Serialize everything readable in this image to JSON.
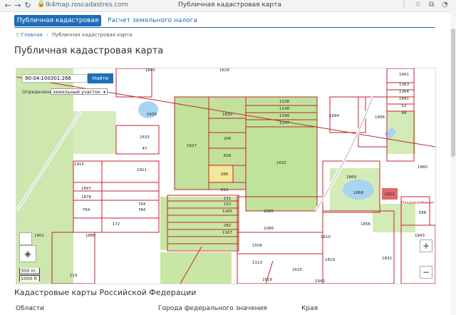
{
  "browser": {
    "url": "lk4map.roscadastres.com",
    "tab_title": "Публичная кадастровая карта"
  },
  "tabs": {
    "active": "Публичная кадастровая карта",
    "other": "Расчет земельного налога"
  },
  "breadcrumb": {
    "home": "Главная",
    "current": "Публичная кадастровая карта"
  },
  "page_title": "Публичная кадастровая карта",
  "map": {
    "search_value": "90:04:100301:266",
    "find_label": "Найти",
    "definition_label": "Определение:",
    "definition_value": "земельный участок",
    "scale_m": "300 m",
    "scale_ft": "1000 ft",
    "zoom_in": "+",
    "zoom_out": "−",
    "labels": [
      "1645",
      "1628",
      "1635",
      "1630",
      "1138",
      "1148",
      "1149",
      "1147",
      "1894",
      "1906",
      "1461",
      "1363",
      "1364",
      "1891",
      "52",
      "48",
      "1633",
      "47",
      "1627",
      "206",
      "818",
      "1632",
      "1880",
      "1915",
      "1911",
      "266",
      "819",
      "1869",
      "1868",
      "1611",
      "1897",
      "1878",
      "151",
      "153",
      "1165",
      "764",
      "784",
      "172",
      "764",
      "282",
      "1167",
      "1085",
      "1086",
      "1856",
      "1888",
      "1901",
      "1506",
      "2113",
      "119",
      "1625",
      "1610",
      "1819",
      "568",
      "1843",
      "1832",
      "1619",
      "1640"
    ],
    "legend_text": "Плодокомбинат"
  },
  "colors": {
    "accent": "#1e6fb7",
    "parcel_line": "#c0262c",
    "green_field": "#bfe39a",
    "selected_parcel": "#f5e79a",
    "water": "#a8d4f0"
  },
  "section": {
    "title": "Кадастровые карты Российской Федерации",
    "columns": [
      "Области",
      "Города федерального значения",
      "Края"
    ]
  }
}
